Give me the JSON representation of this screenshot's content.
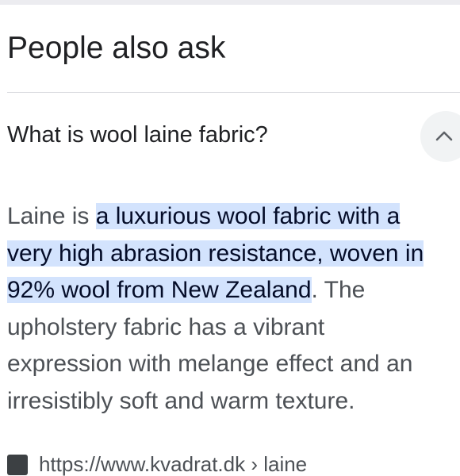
{
  "section": {
    "title": "People also ask"
  },
  "question": {
    "text": "What is wool laine fabric?",
    "toggle_icon": "chevron-up-icon"
  },
  "answer": {
    "line1_plain": "Laine is ",
    "line1_highlight": "a luxurious wool fabric with a",
    "line2_highlight": "very high abrasion resistance, woven in",
    "line3_highlight": "92% wool from New Zealand",
    "line3_plain": ". The",
    "line4": "upholstery fabric has a vibrant",
    "line5": "expression with melange effect and an",
    "line6": "irresistibly soft and warm texture."
  },
  "source": {
    "url": "https://www.kvadrat.dk › laine"
  },
  "colors": {
    "highlight_bg": "#d3e3fd",
    "text": "#202124",
    "answer_text": "#4d5156",
    "toggle_bg": "#f1f3f4"
  }
}
